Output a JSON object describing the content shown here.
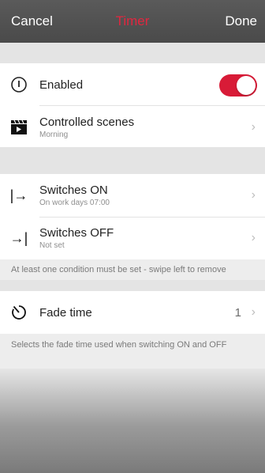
{
  "nav": {
    "cancel": "Cancel",
    "title": "Timer",
    "done": "Done"
  },
  "colors": {
    "accent": "#e2263f",
    "toggle_on": "#d81b37"
  },
  "rows": {
    "enabled": {
      "label": "Enabled",
      "icon": "power-icon",
      "toggle_on": true
    },
    "scenes": {
      "label": "Controlled scenes",
      "sub": "Morning",
      "icon": "clapperboard-icon"
    },
    "switches_on": {
      "label": "Switches ON",
      "sub": "On work days 07:00",
      "icon": "arrow-right-bar-icon"
    },
    "switches_off": {
      "label": "Switches OFF",
      "sub": "Not set",
      "icon": "arrow-right-to-bar-icon"
    },
    "fade": {
      "label": "Fade time",
      "value": "1",
      "icon": "timer-icon"
    }
  },
  "notes": {
    "condition": "At least one condition must be set - swipe left to remove",
    "fade": "Selects the fade time used when switching ON and OFF"
  },
  "glyphs": {
    "chevron": "›",
    "arrow_on": "|→",
    "arrow_off": "→|"
  }
}
